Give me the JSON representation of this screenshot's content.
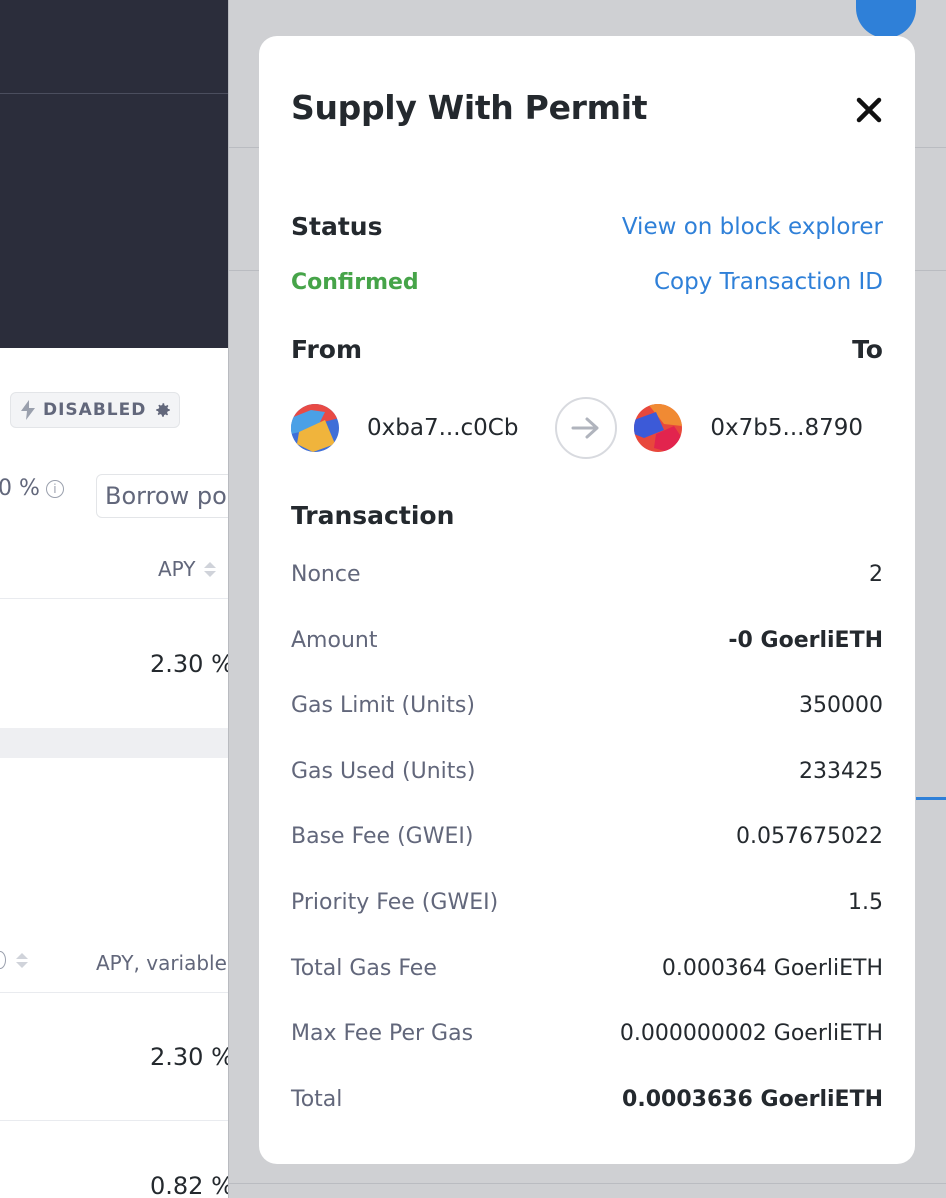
{
  "background": {
    "pill_label": "DISABLED",
    "pct_text": "0 %",
    "input_placeholder": "Borrow po",
    "col_apy": "APY",
    "col_apy_variable": "APY, variable",
    "values": [
      "2.30 %",
      "2.30 %",
      "0.82 %"
    ]
  },
  "modal": {
    "title": "Supply With Permit",
    "status_label": "Status",
    "status_value": "Confirmed",
    "view_explorer_link": "View on block explorer",
    "copy_tx_link": "Copy Transaction ID",
    "from_label": "From",
    "to_label": "To",
    "from_address": "0xba7...c0Cb",
    "to_address": "0x7b5...8790",
    "transaction_label": "Transaction",
    "rows": [
      {
        "label": "Nonce",
        "value": "2",
        "bold": false
      },
      {
        "label": "Amount",
        "value": "-0 GoerliETH",
        "bold": true
      },
      {
        "label": "Gas Limit (Units)",
        "value": "350000",
        "bold": false
      },
      {
        "label": "Gas Used (Units)",
        "value": "233425",
        "bold": false
      },
      {
        "label": "Base Fee (GWEI)",
        "value": "0.057675022",
        "bold": false
      },
      {
        "label": "Priority Fee (GWEI)",
        "value": "1.5",
        "bold": false
      },
      {
        "label": "Total Gas Fee",
        "value": "0.000364 GoerliETH",
        "bold": false
      },
      {
        "label": "Max Fee Per Gas",
        "value": "0.000000002 GoerliETH",
        "bold": false
      },
      {
        "label": "Total",
        "value": "0.0003636 GoerliETH",
        "bold": true
      }
    ]
  },
  "colors": {
    "link": "#2f80d8",
    "confirmed": "#46a449",
    "header_dark": "#2b2d3b"
  }
}
